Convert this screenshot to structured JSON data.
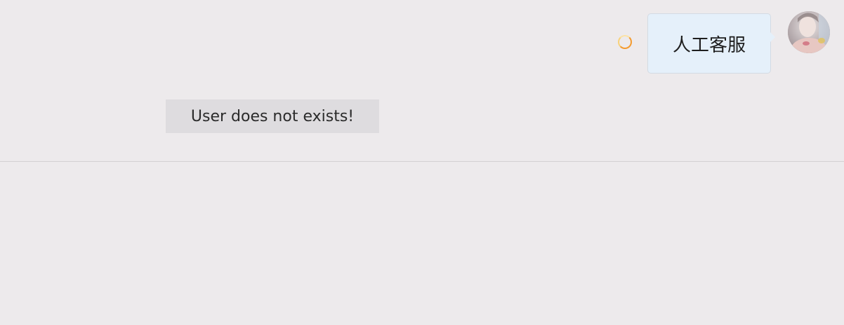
{
  "messages": [
    {
      "text": "人工客服",
      "sender": "user",
      "status": "sending",
      "avatar_icon": "user-avatar"
    }
  ],
  "toast": {
    "text": "User does not exists!"
  },
  "colors": {
    "background": "#edeaec",
    "bubble_background": "#e5f0fa",
    "spinner_accent": "#f49a2e",
    "toast_background": "#dedcdf"
  },
  "composer": {
    "value": ""
  }
}
